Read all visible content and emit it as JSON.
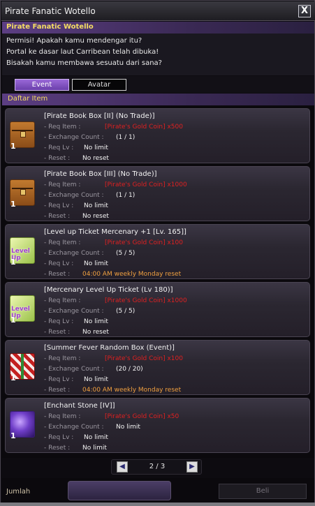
{
  "window": {
    "title": "Pirate Fanatic Wotello",
    "close_label": "X"
  },
  "npc": {
    "name": "Pirate Fanatic Wotello"
  },
  "dialog": {
    "lines": [
      "Permisi! Apakah kamu mendengar itu?",
      "Portal ke dasar laut Carribean telah dibuka!",
      "Bisakah kamu membawa sesuatu dari sana?"
    ]
  },
  "tabs": [
    {
      "label": "Event",
      "active": true
    },
    {
      "label": "Avatar",
      "active": false
    }
  ],
  "list": {
    "header": "Daftar Item"
  },
  "labels": {
    "req_item": "- Req Item :",
    "exchange_count": "- Exchange Count :",
    "req_lv": "- Req Lv :",
    "reset": "- Reset :"
  },
  "items": [
    {
      "name": "[Pirate Book Box [II] (No Trade)]",
      "icon": "treasure-chest-icon",
      "qty": "1",
      "req_item": "[Pirate's Gold Coin] x500",
      "exchange_count": "(1 / 1)",
      "req_lv": "No limit",
      "reset": "No reset"
    },
    {
      "name": "[Pirate Book Box [III] (No Trade)]",
      "icon": "treasure-chest-icon",
      "qty": "1",
      "req_item": "[Pirate's Gold Coin] x1000",
      "exchange_count": "(1 / 1)",
      "req_lv": "No limit",
      "reset": "No reset"
    },
    {
      "name": "[Level up Ticket Mercenary +1 [Lv. 165]]",
      "icon": "level-up-ticket-icon",
      "qty": "1",
      "icon_text": "Level Up",
      "req_item": "[Pirate's Gold Coin] x100",
      "exchange_count": "(5 / 5)",
      "req_lv": "No limit",
      "reset": "04:00 AM weekly Monday reset"
    },
    {
      "name": "[Mercenary Level Up Ticket (Lv 180)]",
      "icon": "level-up-ticket-icon",
      "qty": "1",
      "icon_text": "Level Up",
      "req_item": "[Pirate's Gold Coin] x1000",
      "exchange_count": "(5 / 5)",
      "req_lv": "No limit",
      "reset": "No reset"
    },
    {
      "name": "[Summer Fever Random Box (Event)]",
      "icon": "gift-box-icon",
      "qty": "1",
      "req_item": "[Pirate's Gold Coin] x100",
      "exchange_count": "(20 / 20)",
      "req_lv": "No limit",
      "reset": "04:00 AM weekly Monday reset"
    },
    {
      "name": "[Enchant Stone [IV]]",
      "icon": "enchant-stone-icon",
      "qty": "1",
      "req_item": "[Pirate's Gold Coin] x50",
      "exchange_count": "No limit",
      "req_lv": "No limit",
      "reset": "No limit"
    }
  ],
  "pager": {
    "text": "2 / 3",
    "prev": "◀",
    "next": "▶"
  },
  "footer": {
    "jumlah_label": "Jumlah",
    "buy_label": "Beli"
  },
  "colors": {
    "req_item": "#e02020",
    "reset_weekly": "#f0a040",
    "header_text": "#f5dd63",
    "active_tab": "#7a4cc0"
  }
}
